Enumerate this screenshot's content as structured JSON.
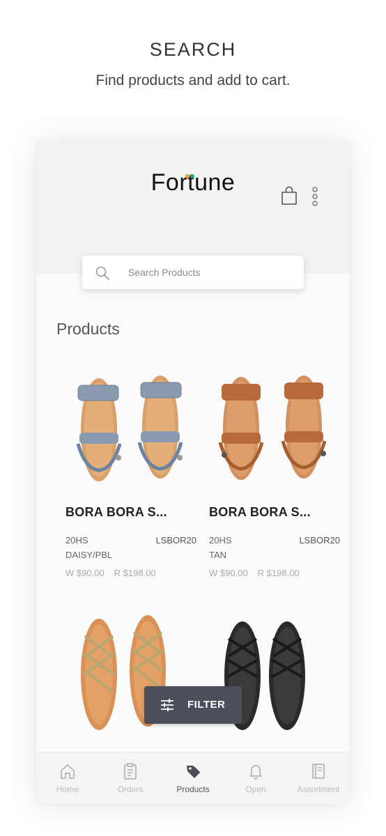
{
  "promo": {
    "title": "SEARCH",
    "subtitle": "Find products and add to cart."
  },
  "header": {
    "logo_text_a": "For",
    "logo_text_b": "t",
    "logo_text_c": "une",
    "icons": [
      "shopping-bag-icon",
      "more-vertical-icon"
    ]
  },
  "search": {
    "placeholder": "Search Products",
    "icon": "search-icon"
  },
  "products_section": {
    "title": "Products",
    "items": [
      {
        "name": "BORA BORA S...",
        "season": "20HS",
        "sku": "LSBOR20",
        "color": "DAISY/PBL",
        "wholesale": "W $90.00",
        "retail": "R $198.00"
      },
      {
        "name": "BORA BORA S...",
        "season": "20HS",
        "sku": "LSBOR20",
        "color": "TAN",
        "wholesale": "W $90.00",
        "retail": "R $198.00"
      }
    ]
  },
  "filter_button": {
    "label": "FILTER",
    "icon": "sliders-icon"
  },
  "bottom_nav": {
    "items": [
      {
        "label": "Home",
        "icon": "home-icon"
      },
      {
        "label": "Orders",
        "icon": "clipboard-icon"
      },
      {
        "label": "Products",
        "icon": "tag-icon"
      },
      {
        "label": "Open",
        "icon": "bell-icon"
      },
      {
        "label": "Assortment",
        "icon": "book-icon"
      }
    ],
    "active": "Products"
  },
  "colors": {
    "filter_bg": "#4a4f5a",
    "logo_dot_orange": "#e5a21a",
    "logo_dot_teal": "#1fa6a0"
  }
}
